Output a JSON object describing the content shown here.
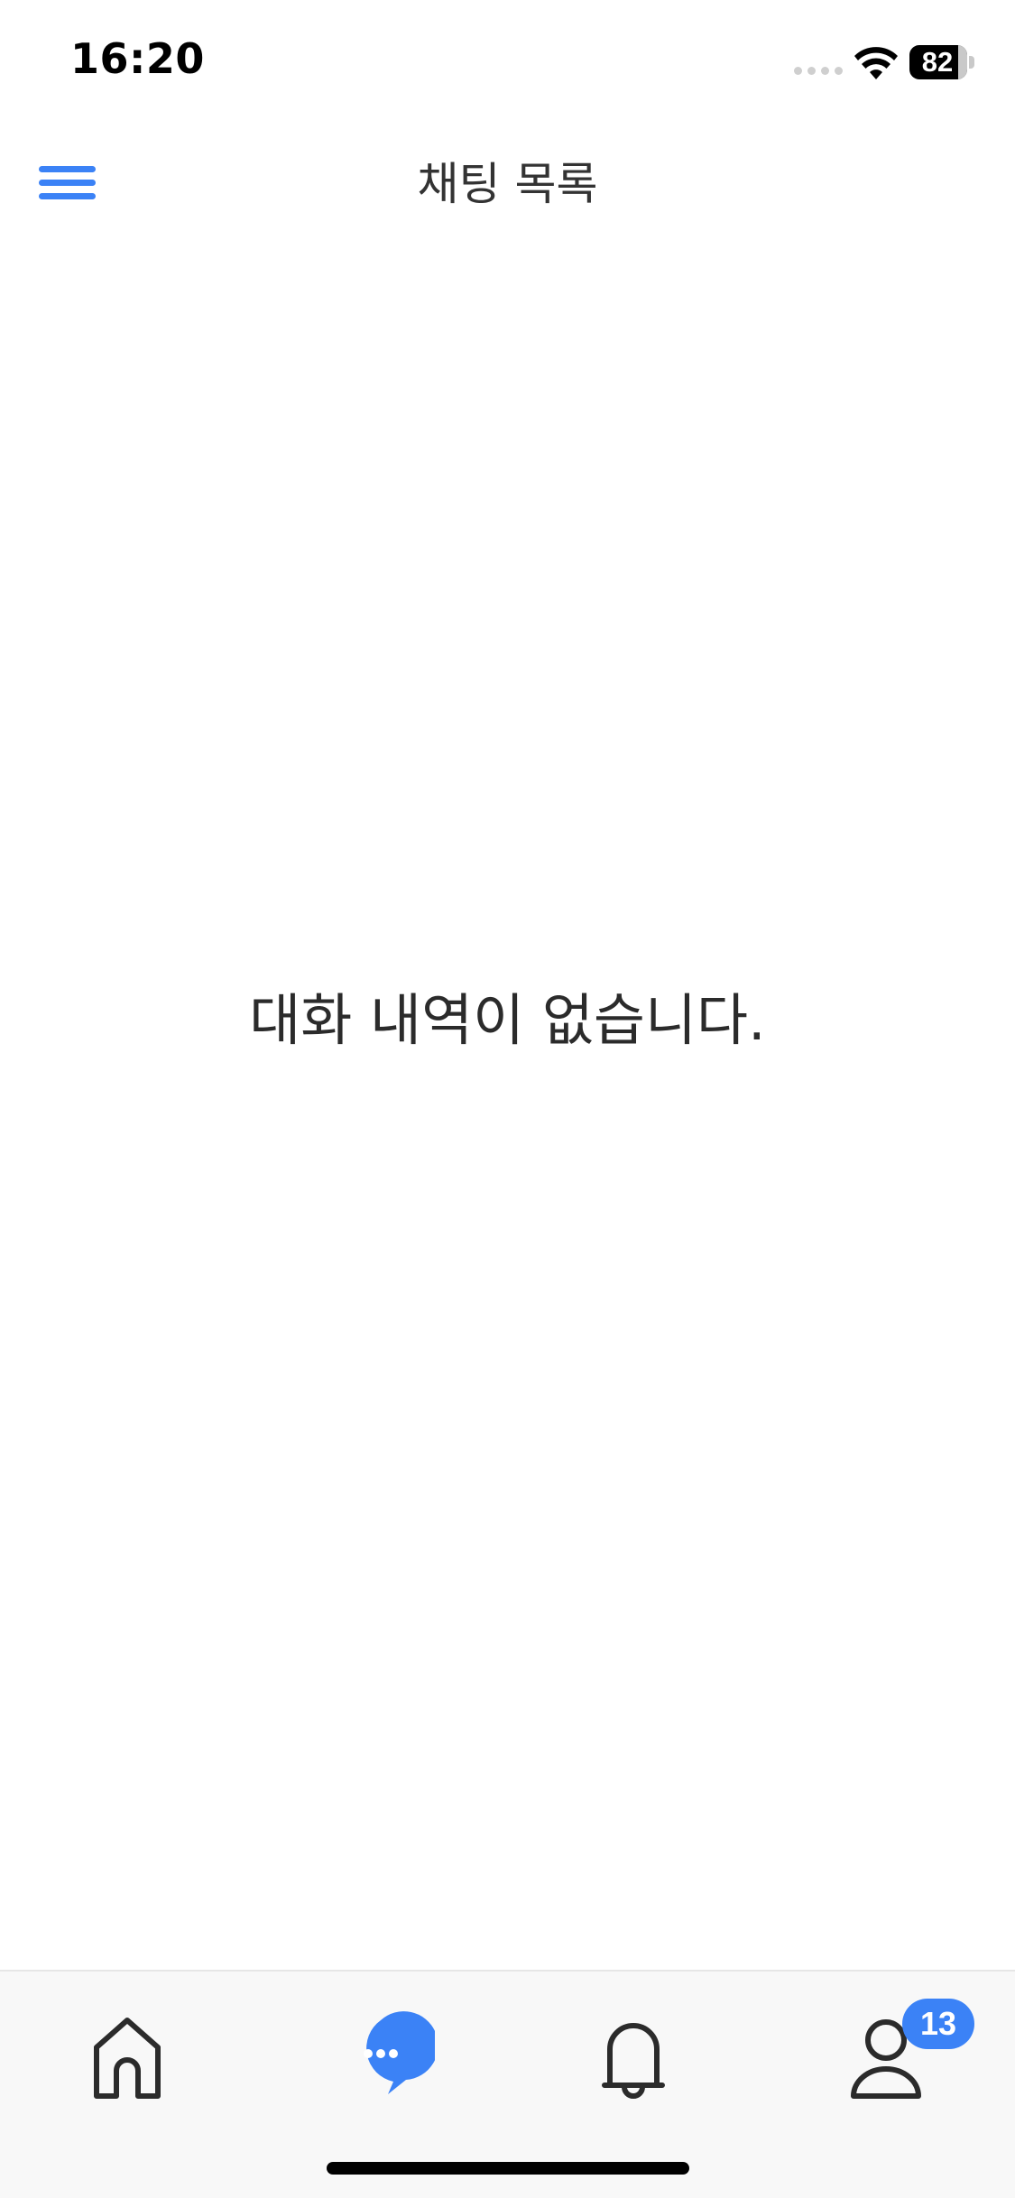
{
  "status_bar": {
    "time": "16:20",
    "battery_level": "82"
  },
  "header": {
    "title": "채팅 목록",
    "menu_icon": "hamburger-menu-icon"
  },
  "empty_state": {
    "message": "대화 내역이 없습니다."
  },
  "tab_bar": {
    "tabs": [
      {
        "icon": "home-icon",
        "active": false
      },
      {
        "icon": "chat-bubble-icon",
        "active": true
      },
      {
        "icon": "bell-icon",
        "active": false
      },
      {
        "icon": "person-icon",
        "active": false,
        "badge": "13"
      }
    ]
  },
  "colors": {
    "accent": "#3b82f6",
    "text": "#2b2b2b",
    "tab_bar_bg": "#f8f8f8"
  }
}
